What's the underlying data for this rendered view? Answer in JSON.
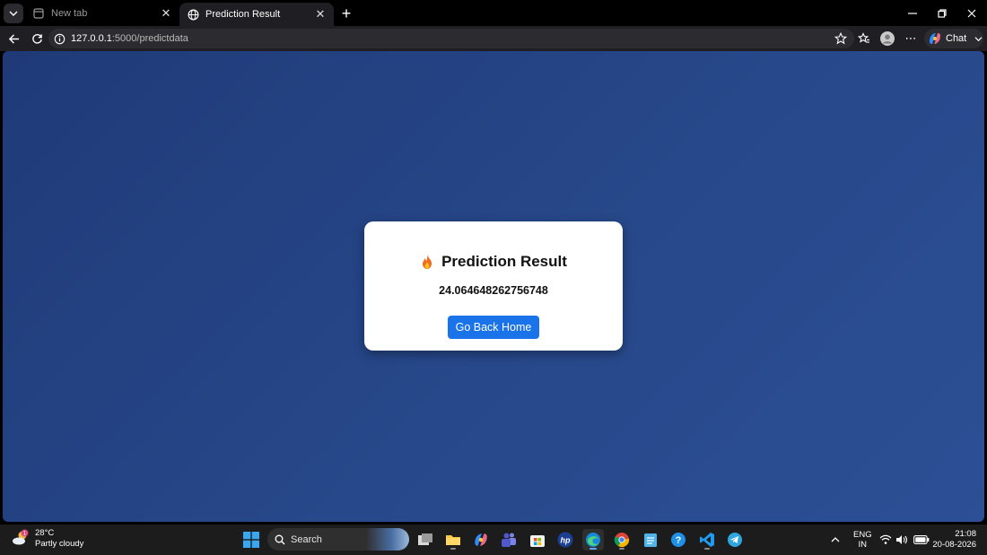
{
  "browser": {
    "tabs": [
      {
        "label": "New tab",
        "active": false
      },
      {
        "label": "Prediction Result",
        "active": true
      }
    ],
    "address": {
      "host": "127.0.0.1",
      "path": ":5000/predictdata"
    },
    "chat_label": "Chat"
  },
  "page": {
    "title": "Prediction Result",
    "result_value": "24.064648262756748",
    "back_button_label": "Go Back Home",
    "colors": {
      "background": "#27488a",
      "card": "#ffffff",
      "button": "#1a73e8"
    }
  },
  "taskbar": {
    "weather": {
      "temperature": "28°C",
      "condition": "Partly cloudy",
      "badge": "1"
    },
    "search_label": "Search",
    "language": {
      "primary": "ENG",
      "secondary": "IN"
    },
    "clock": {
      "time": "21:08",
      "date": "20-08-2026"
    }
  }
}
